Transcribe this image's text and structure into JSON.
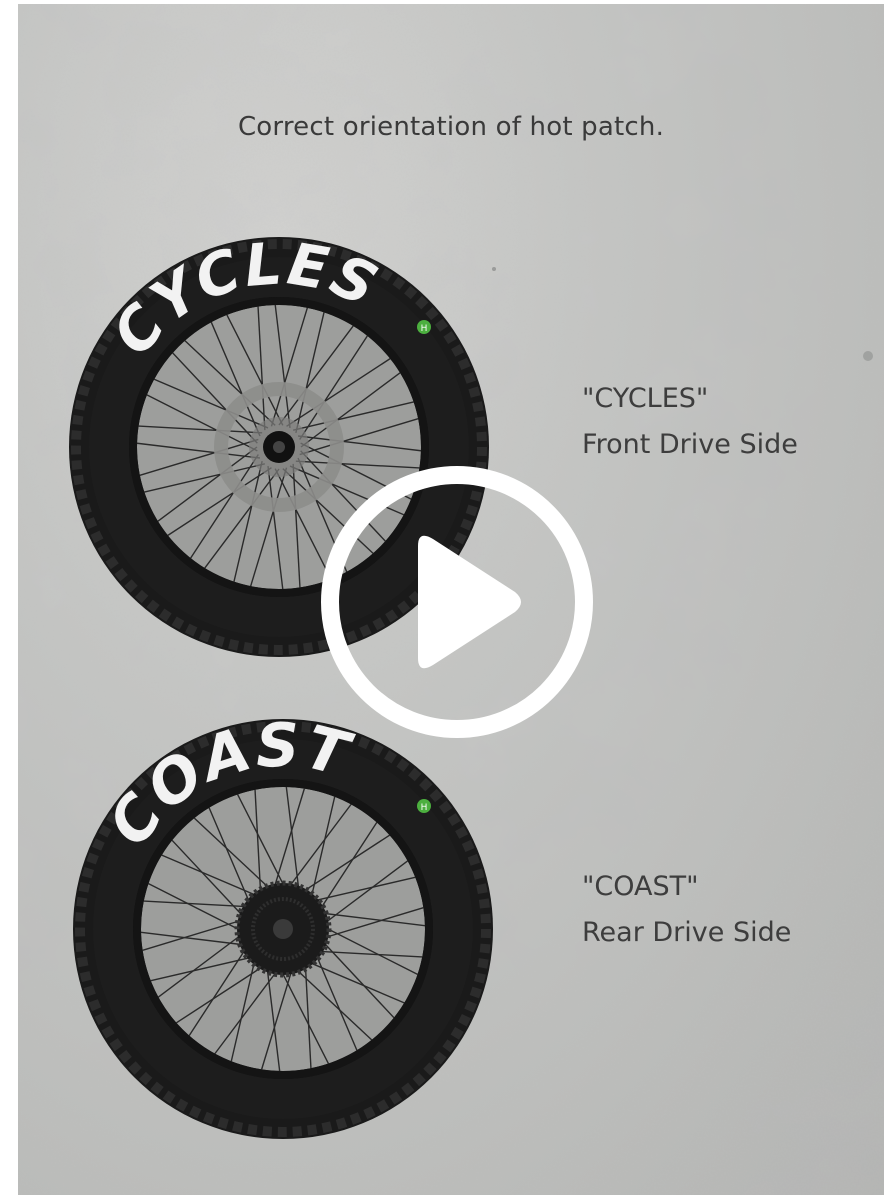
{
  "caption": "Correct orientation of hot patch.",
  "front": {
    "brand_text": "CYCLES",
    "label_line1": "\"CYCLES\"",
    "label_line2": "Front Drive Side"
  },
  "rear": {
    "brand_text": "COAST",
    "label_line1": "\"COAST\"",
    "label_line2": "Rear Drive Side"
  },
  "play_button": {
    "icon": "play-icon",
    "color": "#ffffff"
  },
  "colors": {
    "tire": "#1c1c1c",
    "rim": "#141414",
    "spoke": "#2a2a2a",
    "tire_text": "#f2f2f2",
    "badge": "#4caf3f"
  }
}
